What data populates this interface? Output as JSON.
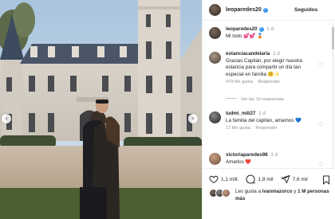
{
  "post": {
    "username": "leoparedes20",
    "follow_status": "Seguidos"
  },
  "caption": {
    "username": "leoparedes20",
    "time": "1 d",
    "text": "Mi todo 💕💕 🥉"
  },
  "comments": [
    {
      "username": "estanciacandelaria",
      "time": "1 d",
      "text": "Gracias Capitán, por elegir nuestra estancia para compartir un día tan especial en familia 🤗✨",
      "likes": "479 Me gusta",
      "reply_label": "Responder",
      "view_replies": "Ver las 10 respuestas"
    },
    {
      "username": "ludmi_mili27",
      "time": "1 d",
      "text": "La familia del capitán, amamos 💙",
      "likes": "17 Me gusta",
      "reply_label": "Responder"
    },
    {
      "username": "victoriaparedes98",
      "time": "1 d",
      "text": "Amarlos ❤️"
    }
  ],
  "actions": {
    "likes_count": "1,1 mill.",
    "comments_count": "1,8 mil",
    "shares_count": "7,6 mil"
  },
  "liked_by": {
    "prefix": "Les gusta a",
    "user": "ivanmazorco",
    "conjunction": "y",
    "others": "1 M personas más"
  },
  "icons": {
    "verified": "verified-badge-icon",
    "heart": "heart-icon",
    "comment": "comment-icon",
    "share": "share-icon",
    "bookmark": "bookmark-icon",
    "prev": "chevron-left-icon",
    "next": "chevron-right-icon"
  },
  "colors": {
    "verified_blue": "#3897f0",
    "meta_gray": "#8e8e8e"
  }
}
